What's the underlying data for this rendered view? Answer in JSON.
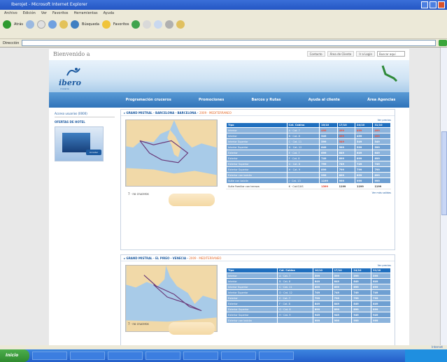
{
  "window": {
    "title": "Iberojet - Microsoft Internet Explorer"
  },
  "menu": [
    "Archivo",
    "Edición",
    "Ver",
    "Favoritos",
    "Herramientas",
    "Ayuda"
  ],
  "toolbar": {
    "back_label": "Atrás",
    "search_label": "Búsqueda",
    "favorites_label": "Favoritos"
  },
  "address": {
    "label": "Dirección",
    "value": ""
  },
  "site": {
    "welcome": "Bienvenido a",
    "top_links": [
      "Contacto",
      "Área de Cliente",
      "Ir a Login"
    ],
    "search_placeholder": "Buscar aquí",
    "logo_text": "ibero",
    "logo_sub": "cruceros",
    "nav": [
      "Programación cruceros",
      "Promociones",
      "Barcos y Rutas",
      "Ayuda al cliente",
      "Área Agencias"
    ]
  },
  "sidebar": {
    "title": "Acceso usuarios (0000)",
    "section": "OFERTAS DE HOTEL",
    "promo_cta": "Acceder"
  },
  "cruises": [
    {
      "title": "GRAND MISTRAL · BARCELONA · BARCELONA ·",
      "title_accent": "2009 · MEDITERRANEO",
      "ship_label": "7 · no cruceros",
      "format_link": "Ver precios",
      "headers": [
        "Tipo",
        "Cat. Cabina",
        "10/10",
        "17/10",
        "24/10",
        "31/10"
      ],
      "rows": [
        {
          "cells": [
            "Interior",
            "A · Cat. 7",
            "499",
            "499",
            "499",
            "499"
          ],
          "hot": [
            true,
            true,
            true,
            true
          ]
        },
        {
          "cells": [
            "Interior",
            "B · Cat. 8",
            "549",
            "499",
            "499",
            "499"
          ],
          "hot": [
            false,
            true,
            false,
            true
          ]
        },
        {
          "cells": [
            "Interior Superior",
            "C · Cat. 11",
            "599",
            "549",
            "549",
            "549"
          ],
          "hot": [
            false,
            true,
            false,
            false
          ]
        },
        {
          "cells": [
            "Interior Superior",
            "D · Cat. 12",
            "649",
            "599",
            "599",
            "599"
          ],
          "hot": [
            false,
            false,
            false,
            false
          ]
        },
        {
          "cells": [
            "Exterior",
            "E · Cat. 7",
            "699",
            "649",
            "649",
            "649"
          ],
          "hot": [
            false,
            false,
            false,
            false
          ]
        },
        {
          "cells": [
            "Exterior",
            "F · Cat. 8",
            "749",
            "699",
            "699",
            "699"
          ],
          "hot": [
            false,
            false,
            false,
            false
          ]
        },
        {
          "cells": [
            "Exterior Superior",
            "G · Cat. 8",
            "799",
            "749",
            "749",
            "749"
          ],
          "hot": [
            false,
            false,
            false,
            false
          ]
        },
        {
          "cells": [
            "Exterior Superior",
            "H · Cat. 9",
            "899",
            "799",
            "799",
            "799"
          ],
          "hot": [
            false,
            false,
            false,
            false
          ]
        },
        {
          "cells": [
            "Exterior con balcón",
            "",
            "999",
            "899",
            "899",
            "899"
          ],
          "hot": [
            false,
            false,
            false,
            false
          ]
        },
        {
          "cells": [
            "Suite con balcón",
            "J · Cat. 13",
            "1199",
            "999",
            "999",
            "999"
          ],
          "hot": [
            false,
            false,
            false,
            false
          ]
        },
        {
          "cells": [
            "Suite Familiar con terraza",
            "K · Cat.E/US",
            "1399",
            "1199",
            "1199",
            "1199"
          ],
          "hot": [
            true,
            false,
            false,
            false
          ],
          "plain": true
        }
      ],
      "more_link": "Ver más salidas"
    },
    {
      "title": "GRAND MISTRAL · EL PIREO · VENECIA ·",
      "title_accent": "2009 · MEDITERRANEO",
      "ship_label": "7 · no cruceros",
      "format_link": "Ver precios",
      "headers": [
        "Tipo",
        "Cat. Cabina",
        "10/10",
        "17/10",
        "24/10",
        "31/10"
      ],
      "rows": [
        {
          "cells": [
            "Interior",
            "A · Cat. 7",
            "599",
            "599",
            "599",
            "599"
          ],
          "hot": [
            false,
            false,
            false,
            false
          ]
        },
        {
          "cells": [
            "Interior",
            "B · Cat. 8",
            "649",
            "649",
            "649",
            "649"
          ],
          "hot": [
            false,
            false,
            false,
            false
          ]
        },
        {
          "cells": [
            "Interior Superior",
            "C · Cat. 11",
            "699",
            "699",
            "699",
            "699"
          ],
          "hot": [
            false,
            false,
            false,
            false
          ]
        },
        {
          "cells": [
            "Interior Superior",
            "D · Cat. 12",
            "749",
            "749",
            "749",
            "749"
          ],
          "hot": [
            false,
            false,
            false,
            false
          ]
        },
        {
          "cells": [
            "Exterior",
            "E · Cat. 7",
            "799",
            "799",
            "799",
            "799"
          ],
          "hot": [
            false,
            false,
            false,
            false
          ]
        },
        {
          "cells": [
            "Exterior",
            "F · Cat. 8",
            "849",
            "849",
            "849",
            "849"
          ],
          "hot": [
            false,
            false,
            false,
            false
          ]
        },
        {
          "cells": [
            "Exterior Superior",
            "G · Cat. 8",
            "899",
            "899",
            "899",
            "899"
          ],
          "hot": [
            false,
            false,
            false,
            false
          ]
        },
        {
          "cells": [
            "Exterior Superior",
            "H · Cat. 9",
            "949",
            "949",
            "949",
            "949"
          ],
          "hot": [
            false,
            false,
            false,
            false
          ]
        },
        {
          "cells": [
            "Exterior con balcón",
            "",
            "999",
            "999",
            "999",
            "999"
          ],
          "hot": [
            false,
            false,
            false,
            false
          ]
        }
      ],
      "more_link": ""
    }
  ],
  "statusbar": {
    "zone": "Internet"
  },
  "taskbar": {
    "start": "Inicio",
    "clock": ""
  },
  "colors": {
    "accent": "#1f6fbf",
    "hot": "#ff4a2b",
    "brand": "#1c5aa0"
  }
}
